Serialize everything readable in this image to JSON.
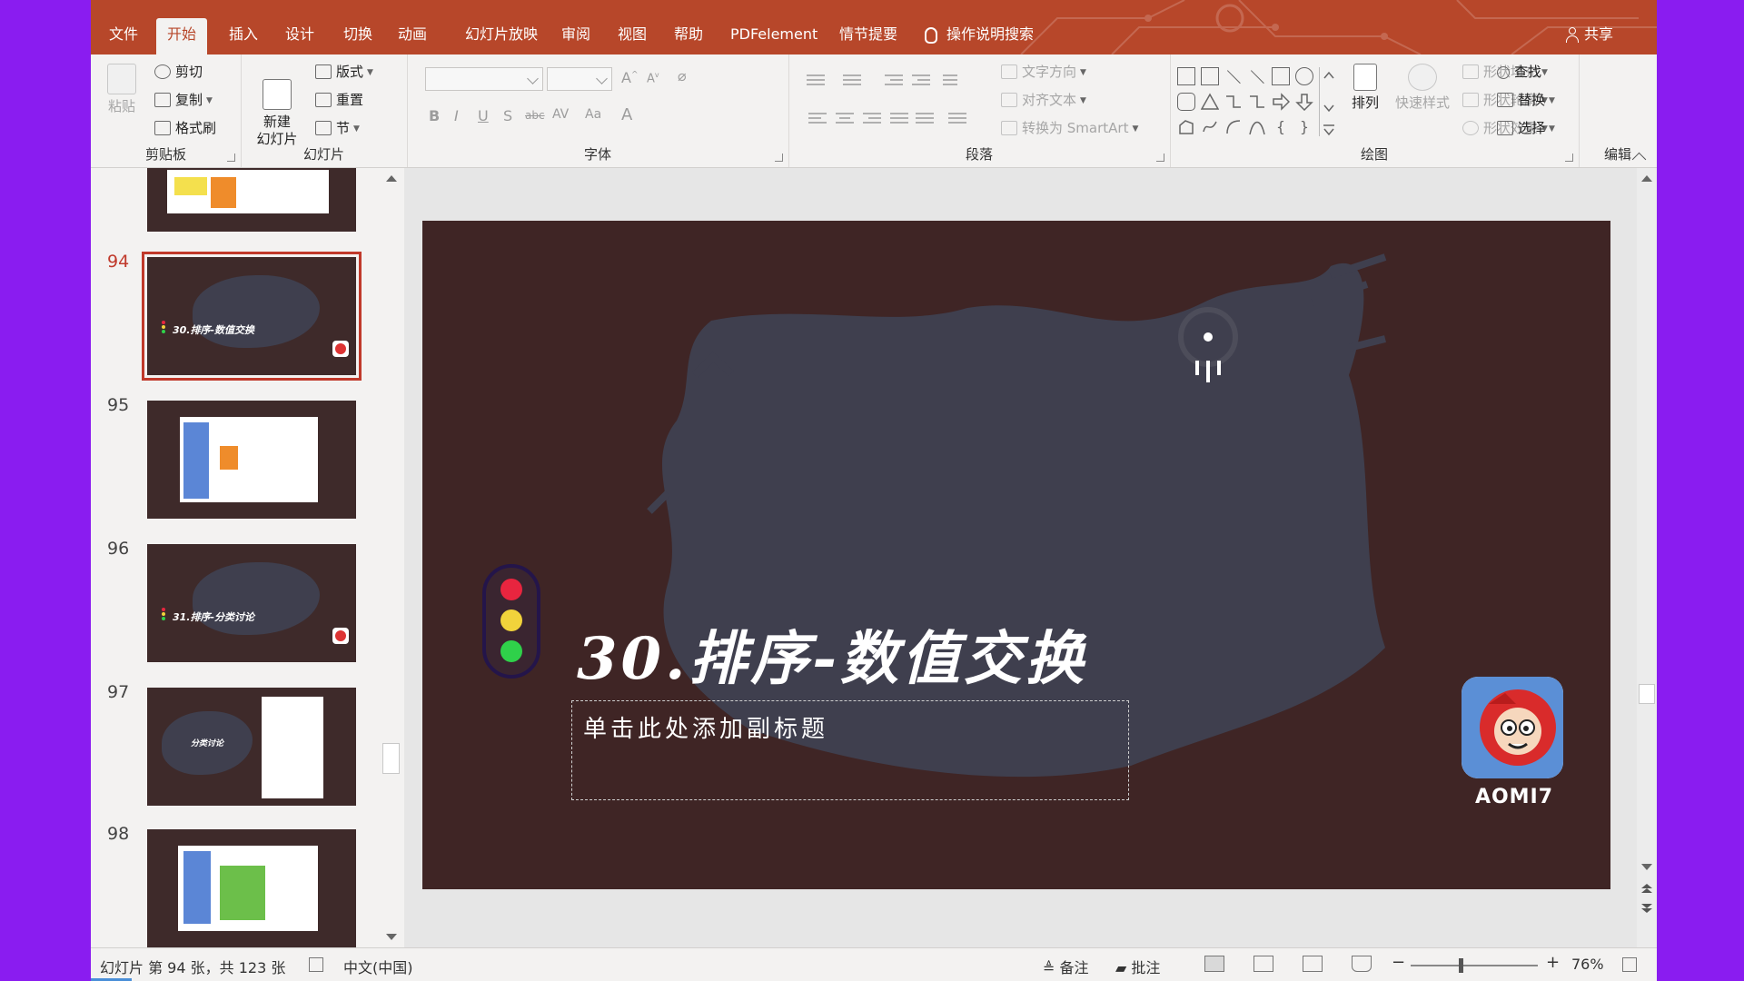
{
  "colors": {
    "accent": "#b7472a",
    "slide_bg": "#3f2525",
    "brush": "#3f3f4e",
    "selected": "#c0392b"
  },
  "tabs": [
    {
      "label": "文件"
    },
    {
      "label": "开始"
    },
    {
      "label": "插入"
    },
    {
      "label": "设计"
    },
    {
      "label": "切换"
    },
    {
      "label": "动画"
    },
    {
      "label": "幻灯片放映"
    },
    {
      "label": "审阅"
    },
    {
      "label": "视图"
    },
    {
      "label": "帮助"
    },
    {
      "label": "PDFelement"
    },
    {
      "label": "情节提要"
    }
  ],
  "active_tab": "开始",
  "tell_me": {
    "label": "操作说明搜索",
    "icon": "lightbulb-icon"
  },
  "share": {
    "label": "共享",
    "icon": "person-icon"
  },
  "ribbon": {
    "clipboard": {
      "label": "剪贴板",
      "paste": "粘贴",
      "cut": "剪切",
      "copy": "复制",
      "format_painter": "格式刷"
    },
    "slides": {
      "label": "幻灯片",
      "new_slide": "新建\n幻灯片",
      "layout": "版式",
      "reset": "重置",
      "section": "节"
    },
    "font": {
      "label": "字体",
      "font_name": "",
      "font_size": ""
    },
    "paragraph": {
      "label": "段落",
      "text_direction": "文字方向",
      "align_text": "对齐文本",
      "convert_smartart": "转换为 SmartArt"
    },
    "drawing": {
      "label": "绘图",
      "arrange": "排列",
      "quick_styles": "快速样式",
      "shape_fill": "形状填充",
      "shape_outline": "形状轮廓",
      "shape_effects": "形状效果"
    },
    "editing": {
      "label": "编辑",
      "find": "查找",
      "replace": "替换",
      "select": "选择"
    }
  },
  "thumbnails": [
    {
      "number": "94",
      "title": "30.排序-数值交换",
      "selected": true
    },
    {
      "number": "95",
      "title": "",
      "selected": false
    },
    {
      "number": "96",
      "title": "31.排序-分类讨论",
      "selected": false
    },
    {
      "number": "97",
      "title": "分类讨论",
      "selected": false
    },
    {
      "number": "98",
      "title": "",
      "selected": false
    }
  ],
  "slide": {
    "title": "30.排序-数值交换",
    "subtitle_placeholder": "单击此处添加副标题",
    "logo_text": "AOMI7",
    "traffic_light": [
      "#e8253f",
      "#f1d33b",
      "#2fd14a"
    ]
  },
  "status": {
    "slide_info": "幻灯片 第 94 张，共 123 张",
    "language": "中文(中国)",
    "notes": "备注",
    "comments": "批注",
    "zoom": "76%",
    "zoom_fraction": 0.38
  }
}
